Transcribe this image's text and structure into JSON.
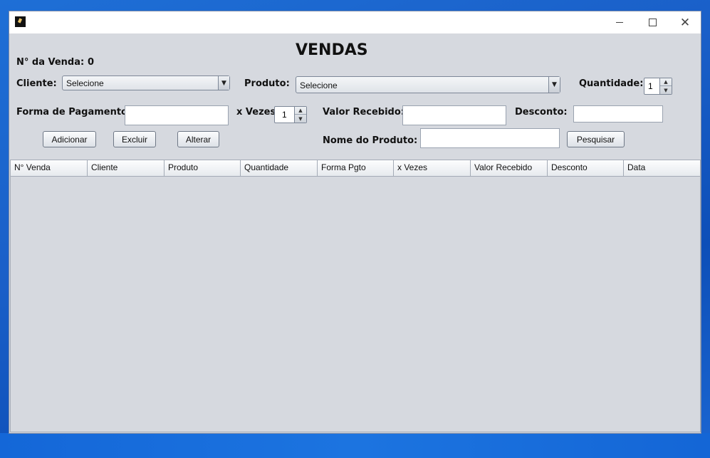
{
  "window": {
    "title_label": "VENDAS"
  },
  "venda": {
    "numero_label": "N° da  Venda:",
    "numero_value": "0"
  },
  "form": {
    "cliente_label": "Cliente:",
    "cliente_selected": "Selecione",
    "produto_label": "Produto:",
    "produto_selected": "Selecione",
    "quantidade_label": "Quantidade:",
    "quantidade_value": "1",
    "forma_pagamento_label": "Forma de Pagamento:",
    "forma_pagamento_value": "",
    "x_vezes_label": "x Vezes",
    "x_vezes_value": "1",
    "valor_recebido_label": "Valor Recebido:",
    "valor_recebido_value": "",
    "desconto_label": "Desconto:",
    "desconto_value": "",
    "nome_produto_label": "Nome do Produto:",
    "nome_produto_value": ""
  },
  "buttons": {
    "adicionar": "Adicionar",
    "excluir": "Excluir",
    "alterar": "Alterar",
    "pesquisar": "Pesquisar"
  },
  "table": {
    "columns": [
      "N° Venda",
      "Cliente",
      "Produto",
      "Quantidade",
      "Forma Pgto",
      "x Vezes",
      "Valor Recebido",
      "Desconto",
      "Data"
    ],
    "rows": []
  },
  "icons": {
    "minimize": "minimize-icon",
    "maximize": "maximize-icon",
    "close": "close-icon"
  }
}
